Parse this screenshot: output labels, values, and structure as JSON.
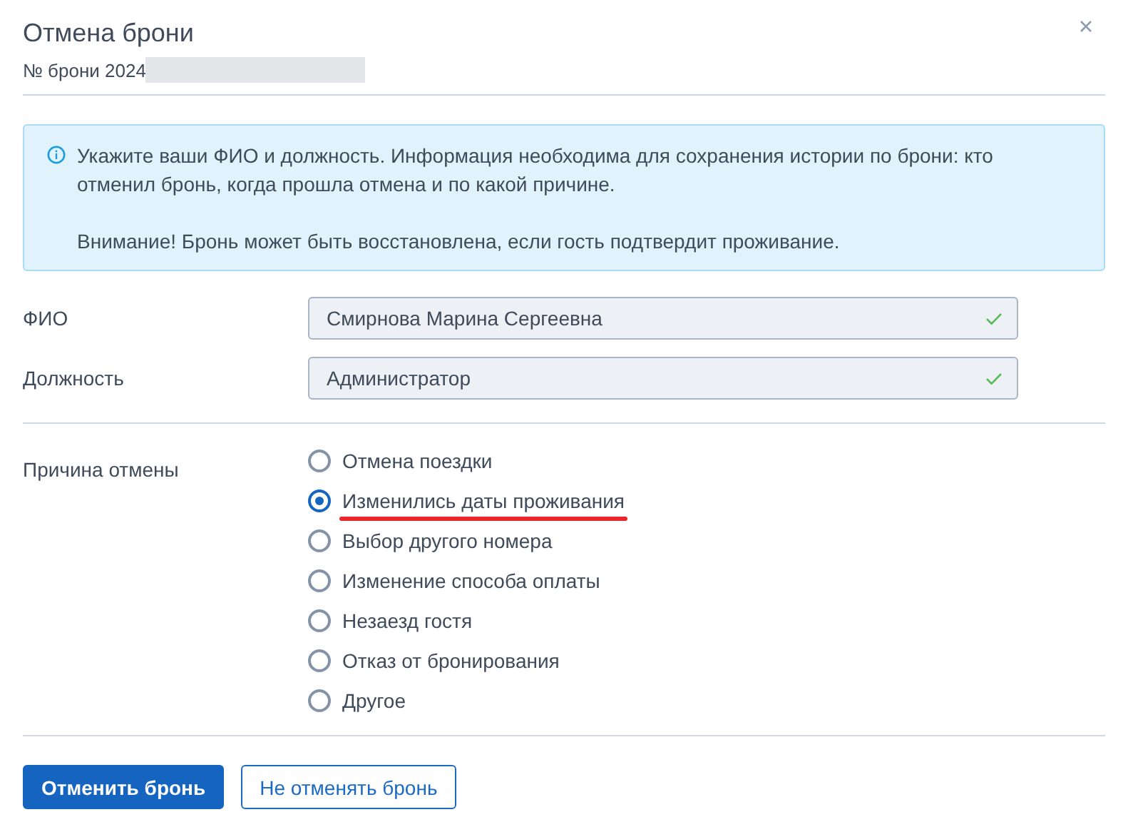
{
  "dialog": {
    "title": "Отмена брони",
    "subtitle": "№ брони 2024",
    "subtitle_redacted": true
  },
  "info": {
    "lines": [
      "Укажите ваши ФИО и должность. Информация необходима для сохранения истории по брони: кто отменил бронь, когда прошла отмена и по какой причине.",
      "Внимание! Бронь может быть восстановлена, если гость подтвердит проживание."
    ]
  },
  "fields": [
    {
      "label": "ФИО",
      "value": "Смирнова Марина Сергеевна",
      "valid": true
    },
    {
      "label": "Должность",
      "value": "Администратор",
      "valid": true
    }
  ],
  "reason": {
    "label": "Причина отмены",
    "options": [
      {
        "label": "Отмена поездки",
        "selected": false,
        "underlined": false
      },
      {
        "label": "Изменились даты проживания",
        "selected": true,
        "underlined": true
      },
      {
        "label": "Выбор другого номера",
        "selected": false,
        "underlined": false
      },
      {
        "label": "Изменение способа оплаты",
        "selected": false,
        "underlined": false
      },
      {
        "label": "Незаезд гостя",
        "selected": false,
        "underlined": false
      },
      {
        "label": "Отказ от бронирования",
        "selected": false,
        "underlined": false
      },
      {
        "label": "Другое",
        "selected": false,
        "underlined": false
      }
    ]
  },
  "buttons": [
    {
      "label": "Отменить бронь",
      "kind": "primary"
    },
    {
      "label": "Не отменять бронь",
      "kind": "secondary"
    }
  ]
}
